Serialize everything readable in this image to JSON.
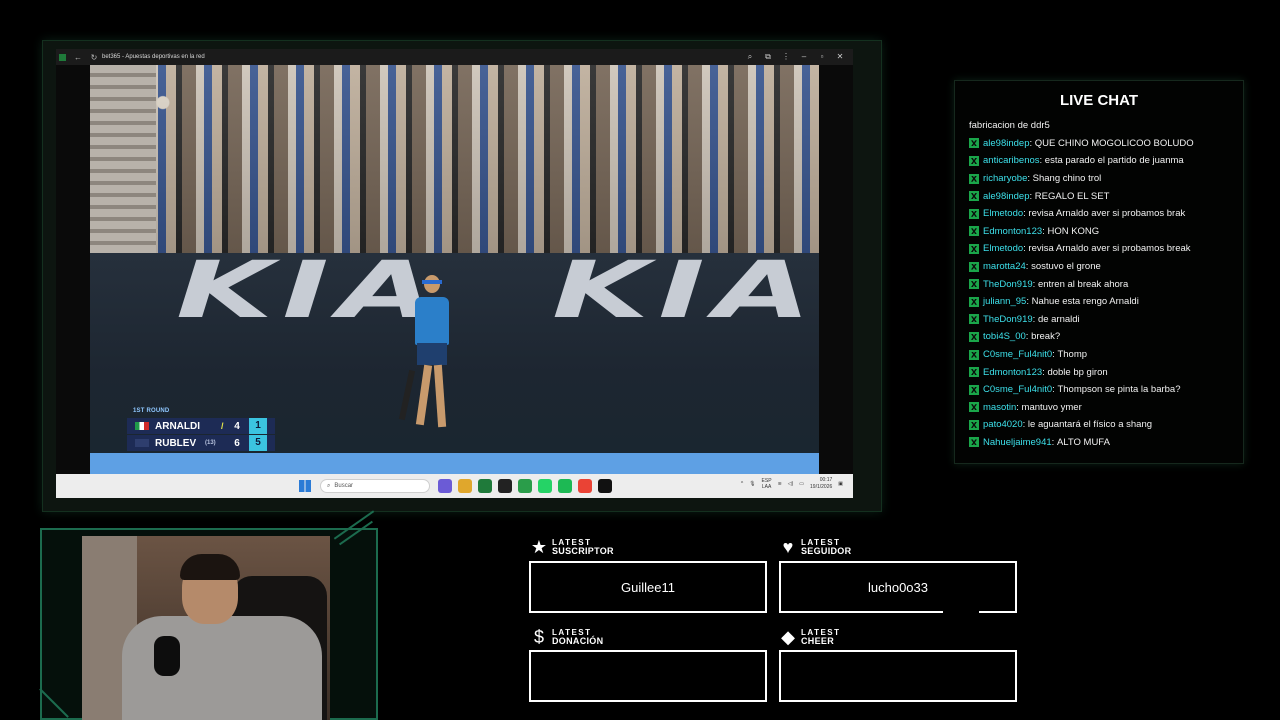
{
  "browser": {
    "tab_title": "bet365 - Apuestas deportivas en la red",
    "back_icon": "arrow-left-icon",
    "reload_icon": "reload-icon"
  },
  "video": {
    "sponsor_left": "KIA",
    "sponsor_right": "KIA",
    "scoreboard": {
      "round": "1ST ROUND",
      "players": [
        {
          "name": "ARNALDI",
          "seed": "",
          "serving": true,
          "games": "4",
          "sets": "1"
        },
        {
          "name": "RUBLEV",
          "seed": "(13)",
          "serving": false,
          "games": "6",
          "sets": "5"
        }
      ]
    }
  },
  "taskbar": {
    "search_placeholder": "Buscar",
    "lang_line1": "ESP",
    "lang_line2": "LAA",
    "time": "00:17",
    "date": "19/1/2026",
    "app_colors": [
      "#6b5bd6",
      "#e0a72c",
      "#1f7a3a",
      "#222222",
      "#2a9d4a",
      "#25d366",
      "#1db954",
      "#ea4335",
      "#111111"
    ]
  },
  "chat": {
    "title": "LIVE CHAT",
    "first_line": "fabricacion de ddr5",
    "messages": [
      {
        "user": "ale98indep",
        "text": "QUE CHINO MOGOLICOO BOLUDO"
      },
      {
        "user": "anticaribenos",
        "text": "esta parado el partido de juanma"
      },
      {
        "user": "richaryobe",
        "text": "Shang chino trol"
      },
      {
        "user": "ale98indep",
        "text": "REGALO EL SET"
      },
      {
        "user": "Elmetodo",
        "text": "revisa Arnaldo aver si probamos brak"
      },
      {
        "user": "Edmonton123",
        "text": "HON KONG"
      },
      {
        "user": "Elmetodo",
        "text": "revisa Arnaldo aver si probamos break"
      },
      {
        "user": "marotta24",
        "text": "sostuvo el grone"
      },
      {
        "user": "TheDon919",
        "text": "entren al break ahora"
      },
      {
        "user": "juliann_95",
        "text": "Nahue esta rengo Arnaldi"
      },
      {
        "user": "TheDon919",
        "text": "de arnaldi"
      },
      {
        "user": "tobi4S_00",
        "text": "break?"
      },
      {
        "user": "C0sme_Ful4nit0",
        "text": "Thomp"
      },
      {
        "user": "Edmonton123",
        "text": "doble bp giron"
      },
      {
        "user": "C0sme_Ful4nit0",
        "text": "Thompson se pinta la barba?"
      },
      {
        "user": "masotin",
        "text": "mantuvo ymer"
      },
      {
        "user": "pato4020",
        "text": "le aguantará el físico a shang"
      },
      {
        "user": "Nahueljaime941",
        "text": "ALTO MUFA"
      }
    ]
  },
  "alerts": {
    "suscriptor": {
      "top": "LATEST",
      "bottom": "SUSCRIPTOR",
      "value": "Guillee11",
      "icon": "star-icon"
    },
    "seguidor": {
      "top": "LATEST",
      "bottom": "SEGUIDOR",
      "value": "lucho0o33",
      "icon": "heart-icon"
    },
    "donacion": {
      "top": "LATEST",
      "bottom": "DONACIÓN",
      "value": "",
      "icon": "dollar-icon"
    },
    "cheer": {
      "top": "LATEST",
      "bottom": "CHEER",
      "value": "",
      "icon": "diamond-icon"
    }
  }
}
